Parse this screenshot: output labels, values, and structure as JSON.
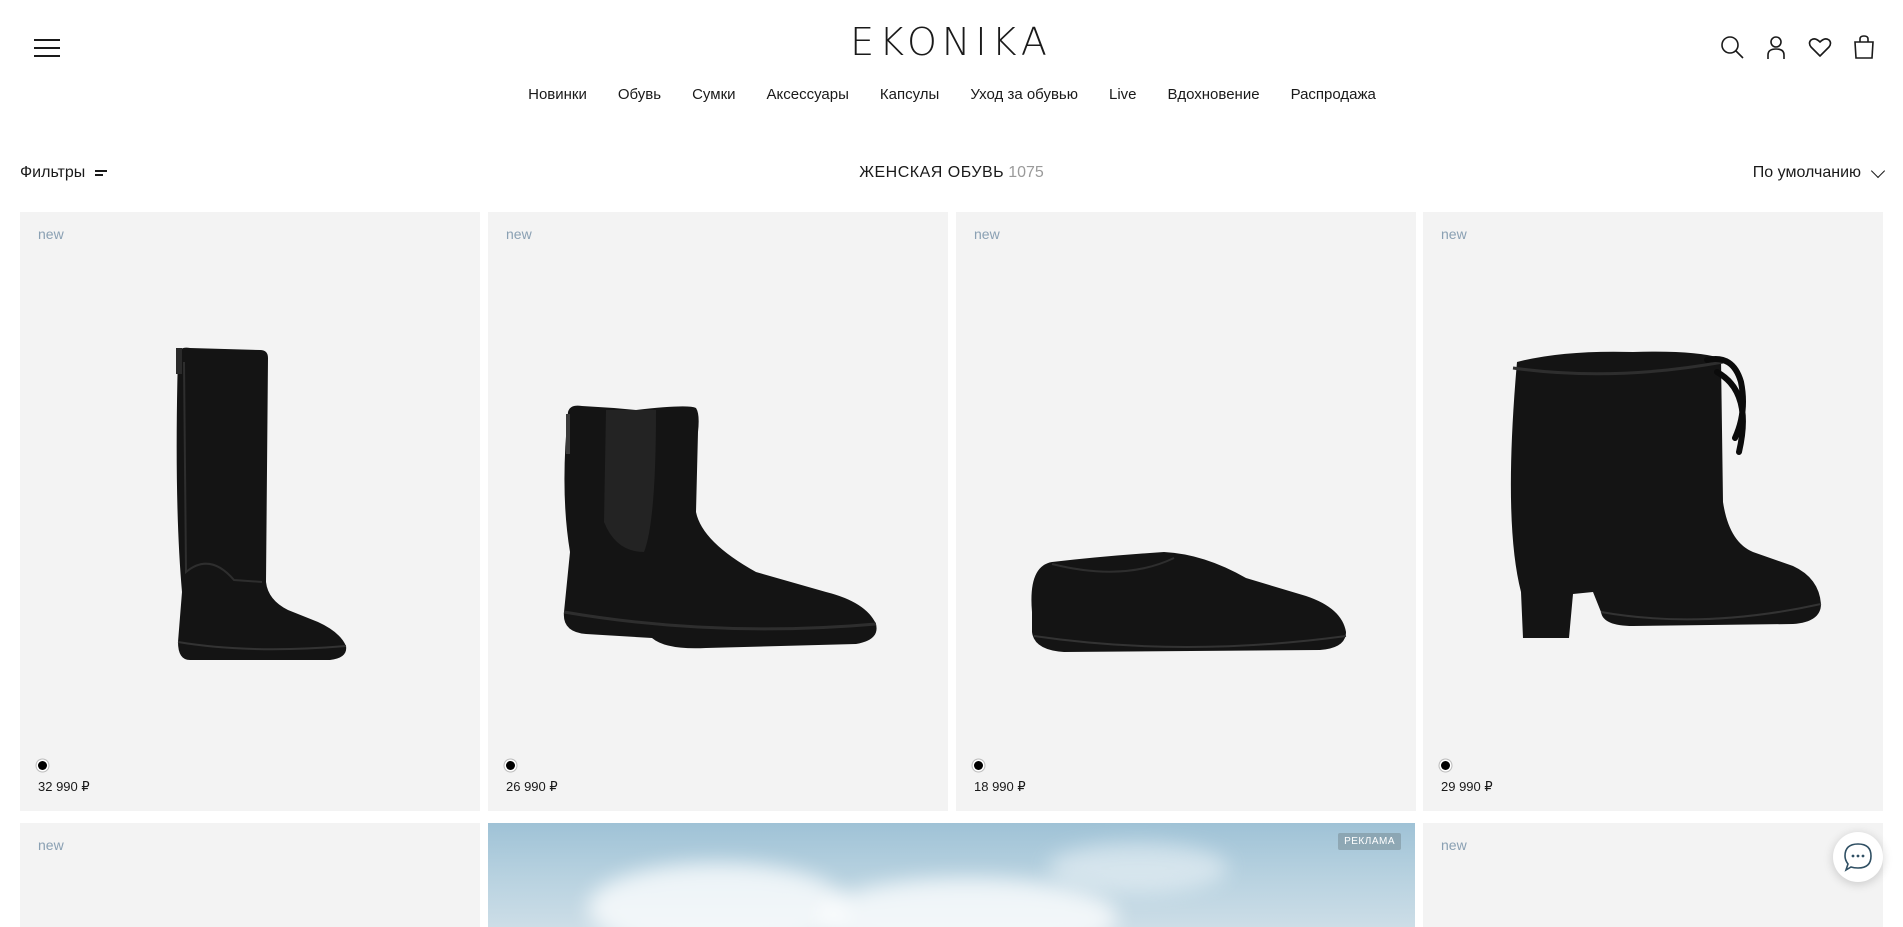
{
  "header": {
    "logo": "EKONIKA",
    "nav": [
      "Новинки",
      "Обувь",
      "Сумки",
      "Аксессуары",
      "Капсулы",
      "Уход за обувью",
      "Live",
      "Вдохновение",
      "Распродажа"
    ],
    "icons": [
      "search-icon",
      "account-icon",
      "heart-icon",
      "bag-icon"
    ]
  },
  "toolbar": {
    "filters_label": "Фильтры",
    "title": "ЖЕНСКАЯ ОБУВЬ",
    "count": "1075",
    "sort_label": "По умолчанию"
  },
  "products": [
    {
      "badge": "new",
      "price": "32 990 ₽",
      "color": "#000000",
      "type": "tall-boot"
    },
    {
      "badge": "new",
      "price": "26 990 ₽",
      "color": "#000000",
      "type": "chelsea-boot"
    },
    {
      "badge": "new",
      "price": "18 990 ₽",
      "color": "#000000",
      "type": "flat"
    },
    {
      "badge": "new",
      "price": "29 990 ₽",
      "color": "#000000",
      "type": "drawstring-boot"
    }
  ],
  "row2": {
    "left_badge": "new",
    "right_badge": "new",
    "ad_label": "РЕКЛАМА"
  },
  "colors": {
    "card_bg": "#f3f3f3",
    "badge_new": "#8aa0b3",
    "count": "#9a9a9a"
  }
}
